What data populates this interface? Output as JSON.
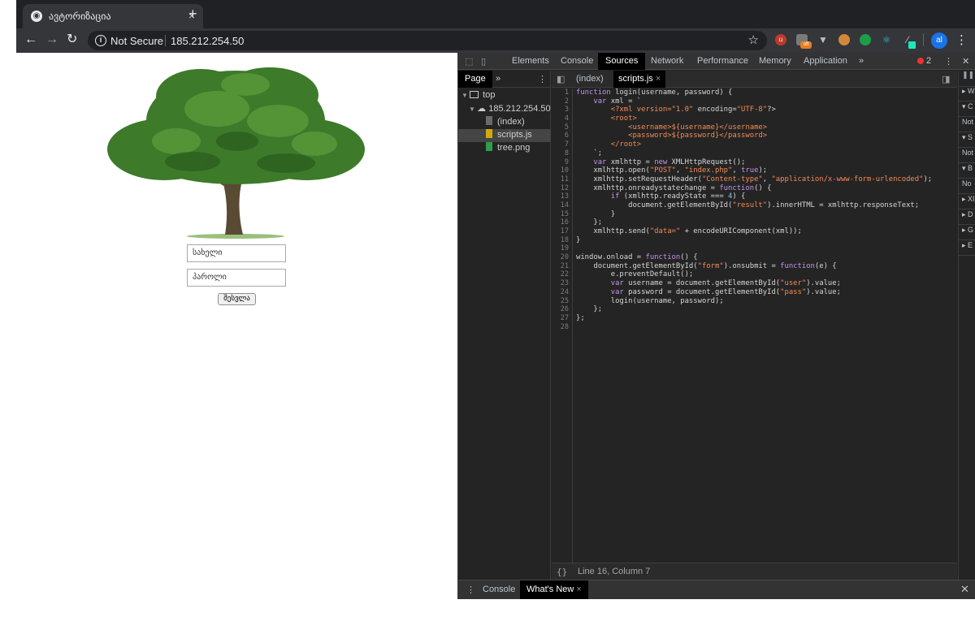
{
  "browser": {
    "tab_title": "ავტორიზაცია",
    "tab_close": "×",
    "new_tab": "+",
    "address": {
      "security": "Not Secure",
      "url": "185.212.254.50"
    },
    "ext_off_badge": "off",
    "avatar_initials": "al"
  },
  "page": {
    "username_placeholder": "სახელი",
    "password_placeholder": "პაროლი",
    "login_button": "შესვლა"
  },
  "devtools": {
    "tabs": [
      "Elements",
      "Console",
      "Sources",
      "Network",
      "Performance",
      "Memory",
      "Application"
    ],
    "active_tab": "Sources",
    "more": "»",
    "error_count": "2",
    "navigator": {
      "tab": "Page",
      "more": "»",
      "tree": [
        {
          "label": "top",
          "level": 0
        },
        {
          "label": "185.212.254.50",
          "level": 1
        },
        {
          "label": "(index)",
          "level": 2
        },
        {
          "label": "scripts.js",
          "level": 2
        },
        {
          "label": "tree.png",
          "level": 2
        }
      ],
      "selected": "scripts.js"
    },
    "editor": {
      "tabs": [
        "(index)",
        "scripts.js"
      ],
      "active": "scripts.js",
      "close": "×",
      "status": "Line 16, Column 7",
      "format_icon": "{}",
      "lines": [
        "function login(username, password) {",
        "    var xml = `",
        "        <?xml version=\"1.0\" encoding=\"UTF-8\"?>",
        "        <root>",
        "            <username>${username}</username>",
        "            <password>${password}</password>",
        "        </root>",
        "    `;",
        "    var xmlhttp = new XMLHttpRequest();",
        "    xmlhttp.open(\"POST\", \"index.php\", true);",
        "    xmlhttp.setRequestHeader(\"Content-type\", \"application/x-www-form-urlencoded\");",
        "    xmlhttp.onreadystatechange = function() {",
        "        if (xmlhttp.readyState === 4) {",
        "            document.getElementById(\"result\").innerHTML = xmlhttp.responseText;",
        "        }",
        "    };",
        "    xmlhttp.send(\"data=\" + encodeURIComponent(xml));",
        "}",
        "",
        "window.onload = function() {",
        "    document.getElementById(\"form\").onsubmit = function(e) {",
        "        e.preventDefault();",
        "        var username = document.getElementById(\"user\").value;",
        "        var password = document.getElementById(\"pass\").value;",
        "        login(username, password);",
        "    };",
        "};",
        ""
      ]
    },
    "right_panel_rows": [
      "▸ W",
      "▾ C",
      "Not",
      "▾ S",
      "Not",
      "▾ B",
      "No",
      "▸ XI",
      "▸ D",
      "▸ G",
      "▸ E"
    ],
    "drawer": {
      "tabs": [
        "Console",
        "What's New"
      ],
      "active": "What's New",
      "close": "×"
    }
  },
  "colors": {
    "devtools_bg": "#242424",
    "keyword": "#c792ea",
    "string": "#f28b54",
    "tree_green": "#3d7a2a"
  }
}
